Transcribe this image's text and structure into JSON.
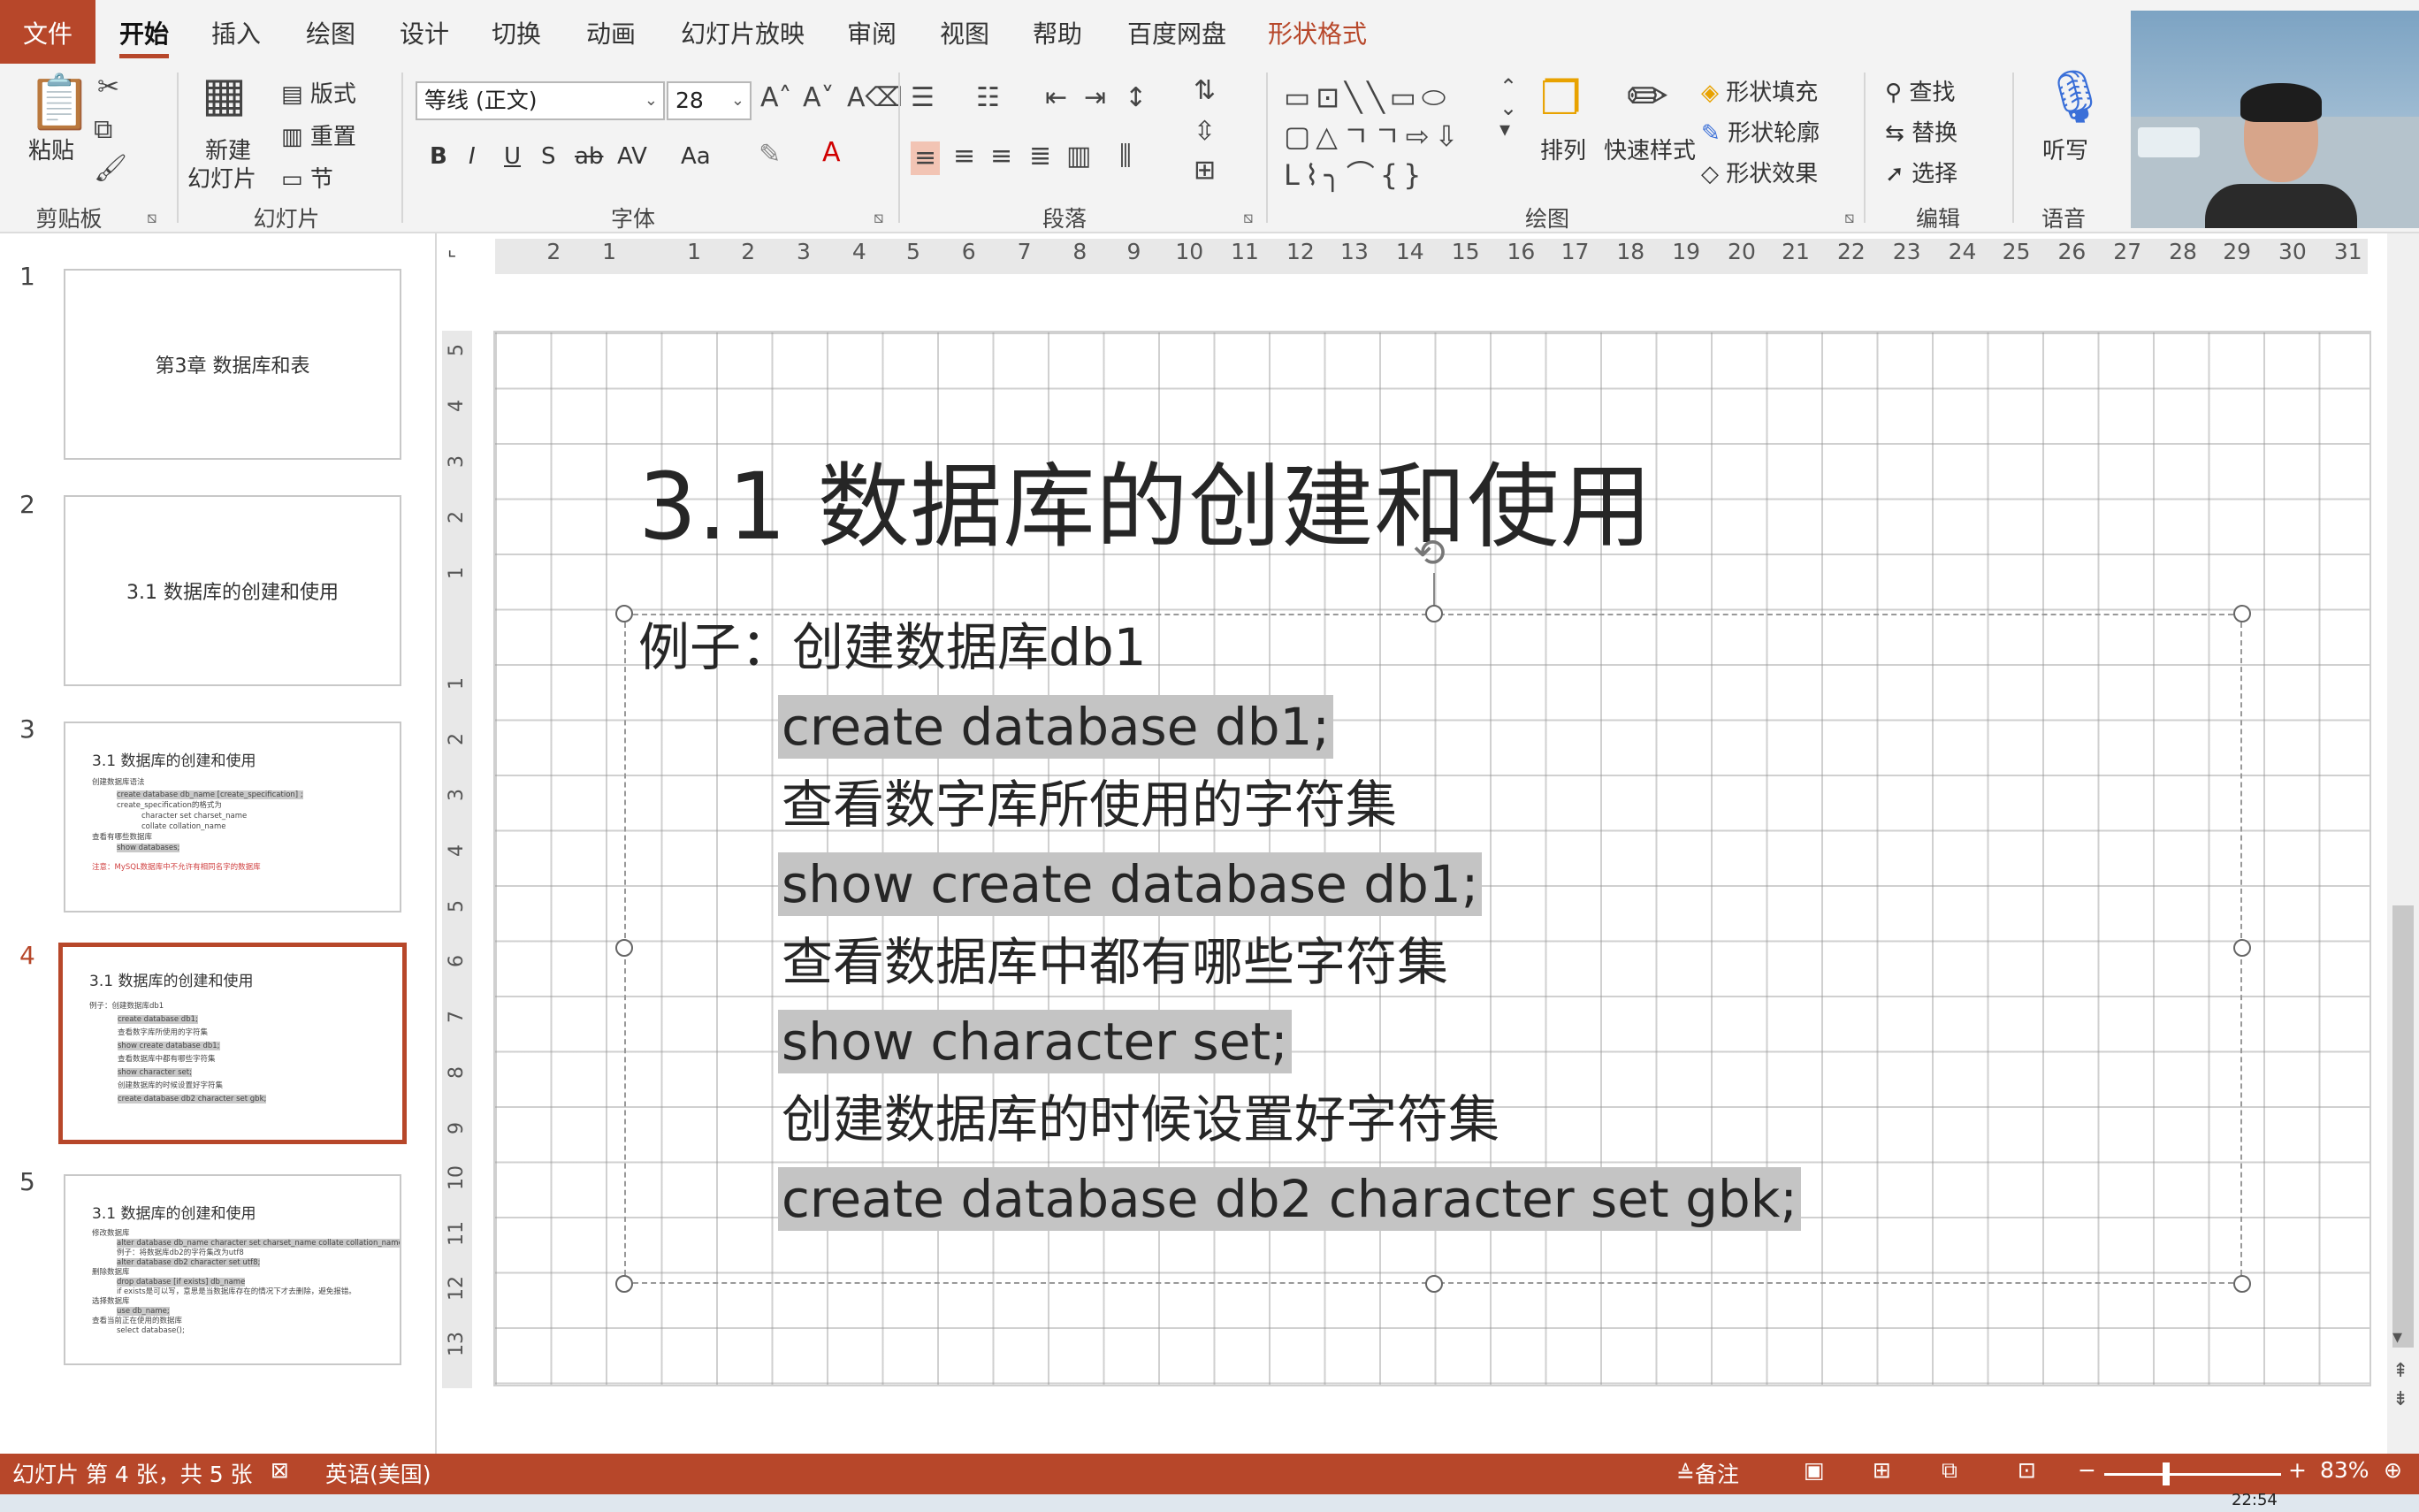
{
  "tabs": [
    "文件",
    "开始",
    "插入",
    "绘图",
    "设计",
    "切换",
    "动画",
    "幻灯片放映",
    "审阅",
    "视图",
    "帮助",
    "百度网盘",
    "形状格式"
  ],
  "ribbon": {
    "clipboard": {
      "paste": "粘贴",
      "label": "剪贴板"
    },
    "slides": {
      "new_slide_1": "新建",
      "new_slide_2": "幻灯片",
      "layout": "版式",
      "reset": "重置",
      "section": "节",
      "label": "幻灯片"
    },
    "font": {
      "name": "等线 (正文)",
      "size": "28",
      "label": "字体",
      "bold": "B",
      "italic": "I",
      "underline": "U",
      "shadow": "S",
      "strike": "ab",
      "spacing": "AV",
      "case": "Aa"
    },
    "paragraph": {
      "label": "段落"
    },
    "drawing": {
      "arrange": "排列",
      "quick_styles": "快速样式",
      "fill": "形状填充",
      "outline": "形状轮廓",
      "effects": "形状效果",
      "label": "绘图"
    },
    "editing": {
      "find": "查找",
      "replace": "替换",
      "select": "选择",
      "label": "编辑"
    },
    "voice": {
      "dictate": "听写",
      "label": "语音"
    }
  },
  "thumbnails": [
    {
      "num": "1",
      "title": "第3章 数据库和表"
    },
    {
      "num": "2",
      "title": "3.1 数据库的创建和使用"
    },
    {
      "num": "3",
      "title": "3.1 数据库的创建和使用",
      "lines": [
        "创建数据库语法",
        "create database db_name [create_specification] ;",
        "create_specification的格式为",
        "character set charset_name",
        "collate collation_name",
        "查看有哪些数据库",
        "show databases;",
        "注意：MySQL数据库中不允许有相同名字的数据库"
      ]
    },
    {
      "num": "4",
      "title": "3.1 数据库的创建和使用",
      "lines": [
        "例子：创建数据库db1",
        "create database db1;",
        "查看数字库所使用的字符集",
        "show create database db1;",
        "查看数据库中都有哪些字符集",
        "show character set;",
        "创建数据库的时候设置好字符集",
        "create database db2 character set gbk;"
      ]
    },
    {
      "num": "5",
      "title": "3.1 数据库的创建和使用",
      "lines": [
        "修改数据库",
        "alter database db_name character set charset_name collate collation_name",
        "例子：将数据库db2的字符集改为utf8",
        "alter database db2 character set utf8;",
        "删除数据库",
        "drop database [if exists] db_name",
        "if exists是可以写，意思是当数据库存在的情况下才去删除，避免报错。",
        "选择数据库",
        "use db_name;",
        "查看当前正在使用的数据库",
        "select database();"
      ]
    }
  ],
  "ruler": {
    "h": [
      "2",
      "1",
      "1",
      "2",
      "3",
      "4",
      "5",
      "6",
      "7",
      "8",
      "9",
      "10",
      "11",
      "12",
      "13",
      "14",
      "15",
      "16",
      "17",
      "18",
      "19",
      "20",
      "21",
      "22",
      "23",
      "24",
      "25",
      "26",
      "27",
      "28",
      "29",
      "30",
      "31"
    ],
    "v": [
      "5",
      "4",
      "3",
      "2",
      "1",
      "1",
      "2",
      "3",
      "4",
      "5",
      "6",
      "7",
      "8",
      "9",
      "10",
      "11",
      "12",
      "13"
    ]
  },
  "slide": {
    "title": "3.1 数据库的创建和使用",
    "lines": [
      {
        "text": "例子：创建数据库db1",
        "code": false
      },
      {
        "text": "create database db1;",
        "code": true
      },
      {
        "text": "查看数字库所使用的字符集",
        "code": false
      },
      {
        "text": "show create database db1;",
        "code": true
      },
      {
        "text": "查看数据库中都有哪些字符集",
        "code": false
      },
      {
        "text": "show character set;",
        "code": true
      },
      {
        "text": "创建数据库的时候设置好字符集",
        "code": false
      },
      {
        "text": "create database db2 character set gbk;",
        "code": true
      }
    ]
  },
  "status": {
    "slide_info": "幻灯片 第 4 张，共 5 张",
    "language": "英语(美国)",
    "notes": "备注",
    "zoom": "83%",
    "zoom_level": 0.33,
    "time": "22:54"
  },
  "colors": {
    "accent": "#b7472a",
    "code_highlight": "#c4c4c4"
  }
}
